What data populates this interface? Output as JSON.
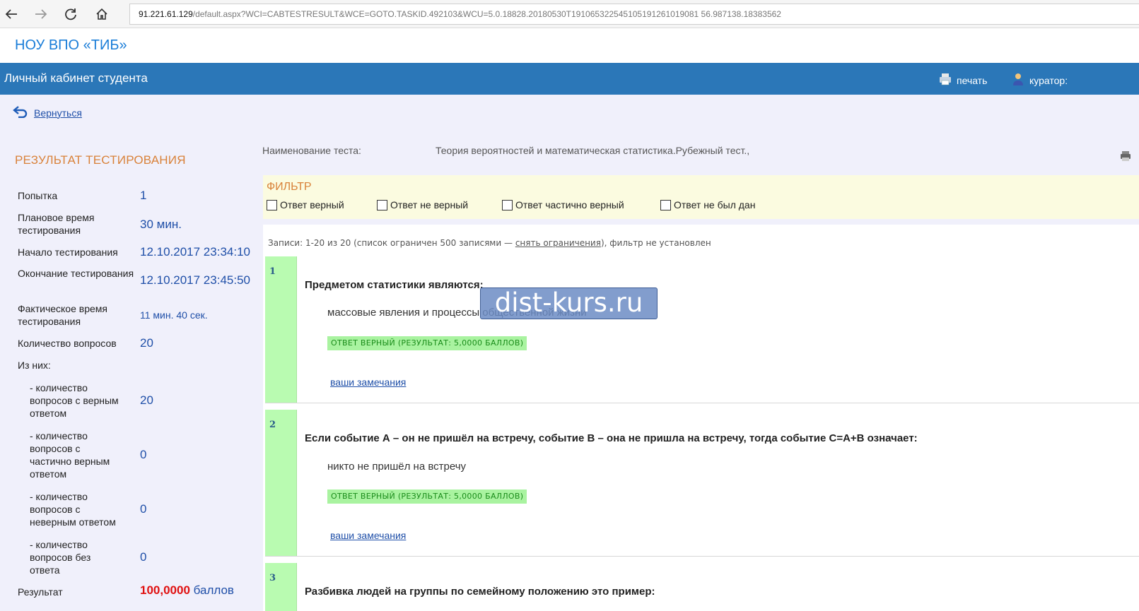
{
  "browser": {
    "url_host": "91.221.61.129",
    "url_path": "/default.aspx?WCI=CABTESTRESULT&WCE=GOTO.TASKID.492103&WCU=5.0.18828.20180530T191065322545105191261019081 56.987138.18383562"
  },
  "site": {
    "title": "НОУ ВПО «ТИБ»",
    "cabinet_title": "Личный кабинет студента",
    "print_label": "печать",
    "curator_label": "куратор:"
  },
  "back_label": "Вернуться",
  "result_heading": "РЕЗУЛЬТАТ ТЕСТИРОВАНИЯ",
  "stats": {
    "attempt_label": "Попытка",
    "attempt_value": "1",
    "planned_label": "Плановое время тестирования",
    "planned_value": "30 мин.",
    "start_label": "Начало тестирования",
    "start_value": "12.10.2017 23:34:10",
    "end_label": "Окончание тестирования",
    "end_value": "12.10.2017 23:45:50",
    "actual_label": "Фактическое время тестирования",
    "actual_value": "11 мин. 40 сек.",
    "count_label": "Количество вопросов",
    "count_value": "20",
    "of_them_label": "Из них:",
    "correct_label": "- количество вопросов с верным ответом",
    "correct_value": "20",
    "partial_label": "- количество вопросов с частично верным ответом",
    "partial_value": "0",
    "wrong_label": "- количество вопросов с неверным ответом",
    "wrong_value": "0",
    "none_label": "- количество вопросов без ответа",
    "none_value": "0",
    "result_label": "Результат",
    "result_value": "100,0000",
    "result_unit": "баллов"
  },
  "test": {
    "name_label": "Наименование теста:",
    "name_value": "Теория вероятностей и математическая статистика.Рубежный тест.,"
  },
  "filter": {
    "title": "ФИЛЬТР",
    "options": [
      "Ответ верный",
      "Ответ не верный",
      "Ответ частично верный",
      "Ответ не был дан"
    ]
  },
  "records": {
    "prefix": "Записи: 1-20 из 20 (список ограничен 500 записями —",
    "link": "снять ограничения",
    "suffix": "), фильтр не установлен"
  },
  "questions": [
    {
      "num": "1",
      "text": "Предметом статистики являются:",
      "answer": "массовые явления и процессы общественной жизни",
      "badge": "ОТВЕТ ВЕРНЫЙ (РЕЗУЛЬТАТ: 5,0000 БАЛЛОВ)",
      "remark": "ваши замечания"
    },
    {
      "num": "2",
      "text": "Если событие А – он не пришёл на встречу, событие В – она не пришла на встречу, тогда событие С=А+В означает:",
      "answer": "никто не пришёл на встречу",
      "badge": "ОТВЕТ ВЕРНЫЙ (РЕЗУЛЬТАТ: 5,0000 БАЛЛОВ)",
      "remark": "ваши замечания"
    },
    {
      "num": "3",
      "text": "Разбивка людей на группы по семейному положению это пример:"
    }
  ],
  "watermark": "dist-kurs.ru"
}
